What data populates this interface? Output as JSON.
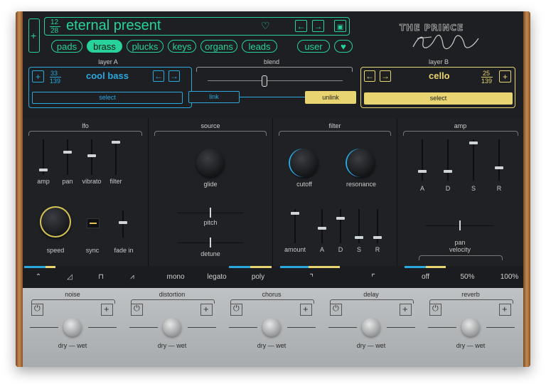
{
  "preset": {
    "index": "12",
    "total": "28",
    "name": "eternal present"
  },
  "categories": [
    "pads",
    "brass",
    "plucks",
    "keys",
    "organs",
    "leads"
  ],
  "active_category": "brass",
  "user_label": "user",
  "brand": {
    "title": "THE PRINCE",
    "signature": "Frank Prince"
  },
  "layer_a": {
    "title": "layer A",
    "index": "33",
    "total": "139",
    "name": "cool bass",
    "select": "select",
    "link": "link"
  },
  "blend": {
    "title": "blend"
  },
  "layer_b": {
    "title": "layer B",
    "index": "25",
    "total": "139",
    "name": "cello",
    "unlink": "unlink",
    "select": "select"
  },
  "lfo": {
    "title": "lfo",
    "sliders": [
      "amp",
      "pan",
      "vibrato",
      "filter"
    ],
    "speed": "speed",
    "sync": "sync",
    "fade_in": "fade in"
  },
  "source": {
    "title": "source",
    "glide": "glide",
    "pitch": "pitch",
    "detune": "detune",
    "modes": [
      "mono",
      "legato",
      "poly"
    ]
  },
  "filter": {
    "title": "filter",
    "cutoff": "cutoff",
    "resonance": "resonance",
    "amount": "amount",
    "adsr": [
      "A",
      "D",
      "S",
      "R"
    ]
  },
  "amp": {
    "title": "amp",
    "adsr": [
      "A",
      "D",
      "S",
      "R"
    ],
    "pan": "pan",
    "velocity": "velocity",
    "velocity_options": [
      "off",
      "50%",
      "100%"
    ]
  },
  "effects": [
    {
      "title": "noise",
      "mix": "dry — wet"
    },
    {
      "title": "distortion",
      "mix": "dry — wet"
    },
    {
      "title": "chorus",
      "mix": "dry — wet"
    },
    {
      "title": "delay",
      "mix": "dry — wet"
    },
    {
      "title": "reverb",
      "mix": "dry — wet"
    }
  ]
}
